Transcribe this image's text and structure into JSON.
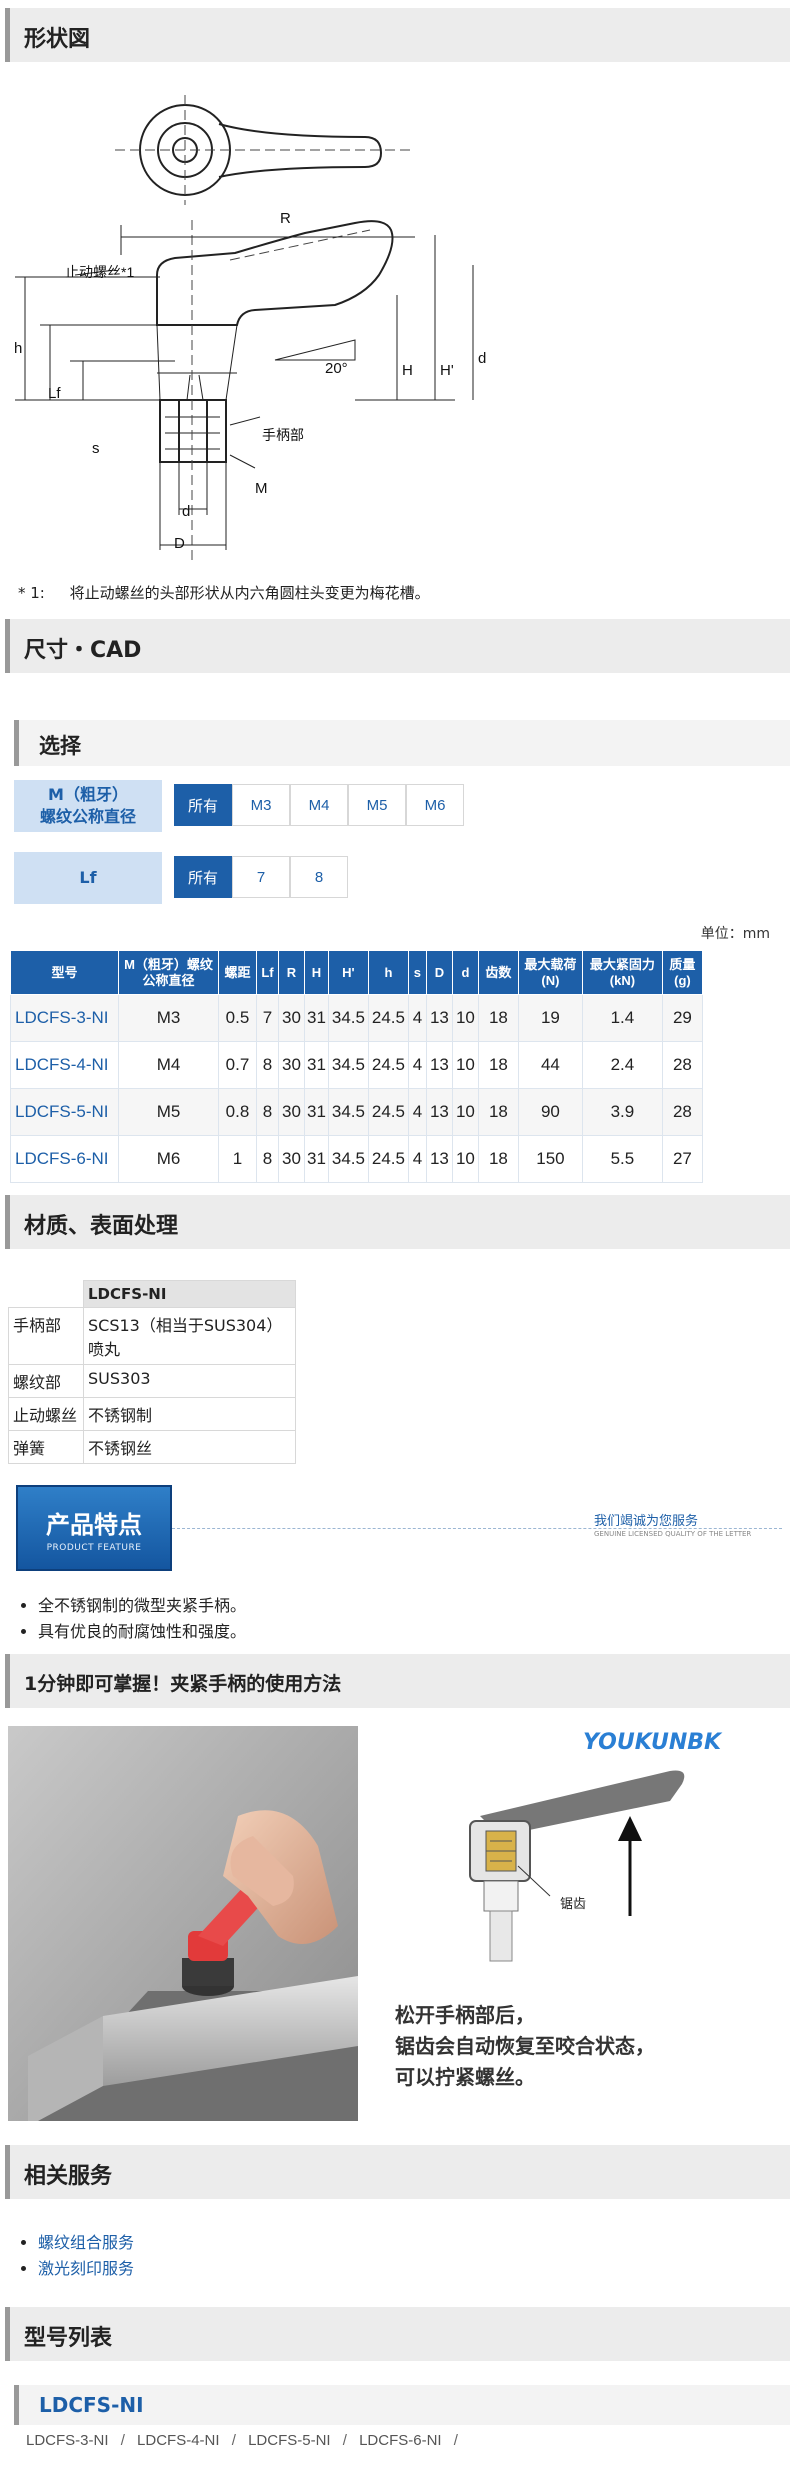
{
  "sections": {
    "shape": "形状図",
    "dims": "尺寸・CAD",
    "material": "材质、表面处理",
    "howto": "1分钟即可掌握！夹紧手柄的使用方法",
    "related": "相关服务",
    "models": "型号列表"
  },
  "drawing_labels": {
    "R": "R",
    "H": "H",
    "H2": "H'",
    "h": "h",
    "d": "d",
    "d_small": "d",
    "D": "D",
    "M": "M",
    "Lf": "Lf",
    "s": "s",
    "angle": "20°",
    "stop_screw": "止动螺丝*1",
    "handle": "手柄部"
  },
  "footnote": {
    "mark": "* 1:",
    "text": "将止动螺丝的头部形状从内六角圆柱头变更为梅花槽。"
  },
  "selection": {
    "title": "选择",
    "rows": [
      {
        "label_line1": "M（粗牙）",
        "label_line2": "螺纹公称直径",
        "options": [
          "所有",
          "M3",
          "M4",
          "M5",
          "M6"
        ]
      },
      {
        "label_line1": "Lf",
        "label_line2": "",
        "options": [
          "所有",
          "7",
          "8"
        ]
      }
    ]
  },
  "unit_note": "单位：mm",
  "spec_table": {
    "headers": [
      "型号",
      "M（粗牙）螺纹公称直径",
      "螺距",
      "Lf",
      "R",
      "H",
      "H'",
      "h",
      "s",
      "D",
      "d",
      "齿数",
      "最大载荷(N)",
      "最大紧固力(kN)",
      "质量(g)"
    ],
    "rows": [
      [
        "LDCFS-3-NI",
        "M3",
        "0.5",
        "7",
        "30",
        "31",
        "34.5",
        "24.5",
        "4",
        "13",
        "10",
        "18",
        "19",
        "1.4",
        "29"
      ],
      [
        "LDCFS-4-NI",
        "M4",
        "0.7",
        "8",
        "30",
        "31",
        "34.5",
        "24.5",
        "4",
        "13",
        "10",
        "18",
        "44",
        "2.4",
        "28"
      ],
      [
        "LDCFS-5-NI",
        "M5",
        "0.8",
        "8",
        "30",
        "31",
        "34.5",
        "24.5",
        "4",
        "13",
        "10",
        "18",
        "90",
        "3.9",
        "28"
      ],
      [
        "LDCFS-6-NI",
        "M6",
        "1",
        "8",
        "30",
        "31",
        "34.5",
        "24.5",
        "4",
        "13",
        "10",
        "18",
        "150",
        "5.5",
        "27"
      ]
    ]
  },
  "material_table": {
    "header": "LDCFS-NI",
    "rows": [
      {
        "part": "手柄部",
        "value": "SCS13（相当于SUS304）喷丸"
      },
      {
        "part": "螺纹部",
        "value": "SUS303"
      },
      {
        "part": "止动螺丝",
        "value": "不锈钢制"
      },
      {
        "part": "弹簧",
        "value": "不锈钢丝"
      }
    ]
  },
  "feature_banner": {
    "title": "产品特点",
    "subtitle": "PRODUCT FEATURE",
    "slogan": "我们竭诚为您服务",
    "slogan_sub": "GENUINE LICENSED QUALITY OF THE LETTER"
  },
  "features": [
    "全不锈钢制的微型夹紧手柄。",
    "具有优良的耐腐蚀性和强度。"
  ],
  "howto_image": {
    "logo": "YOUKUNBK",
    "tooth_label": "锯齿",
    "caption": [
      "松开手柄部后，",
      "锯齿会自动恢复至咬合状态，",
      "可以拧紧螺丝。"
    ]
  },
  "related_services": [
    "螺纹组合服务",
    "激光刻印服务"
  ],
  "model_list": {
    "group": "LDCFS-NI",
    "items": [
      "LDCFS-3-NI",
      "LDCFS-4-NI",
      "LDCFS-5-NI",
      "LDCFS-6-NI"
    ],
    "separator": "/"
  }
}
